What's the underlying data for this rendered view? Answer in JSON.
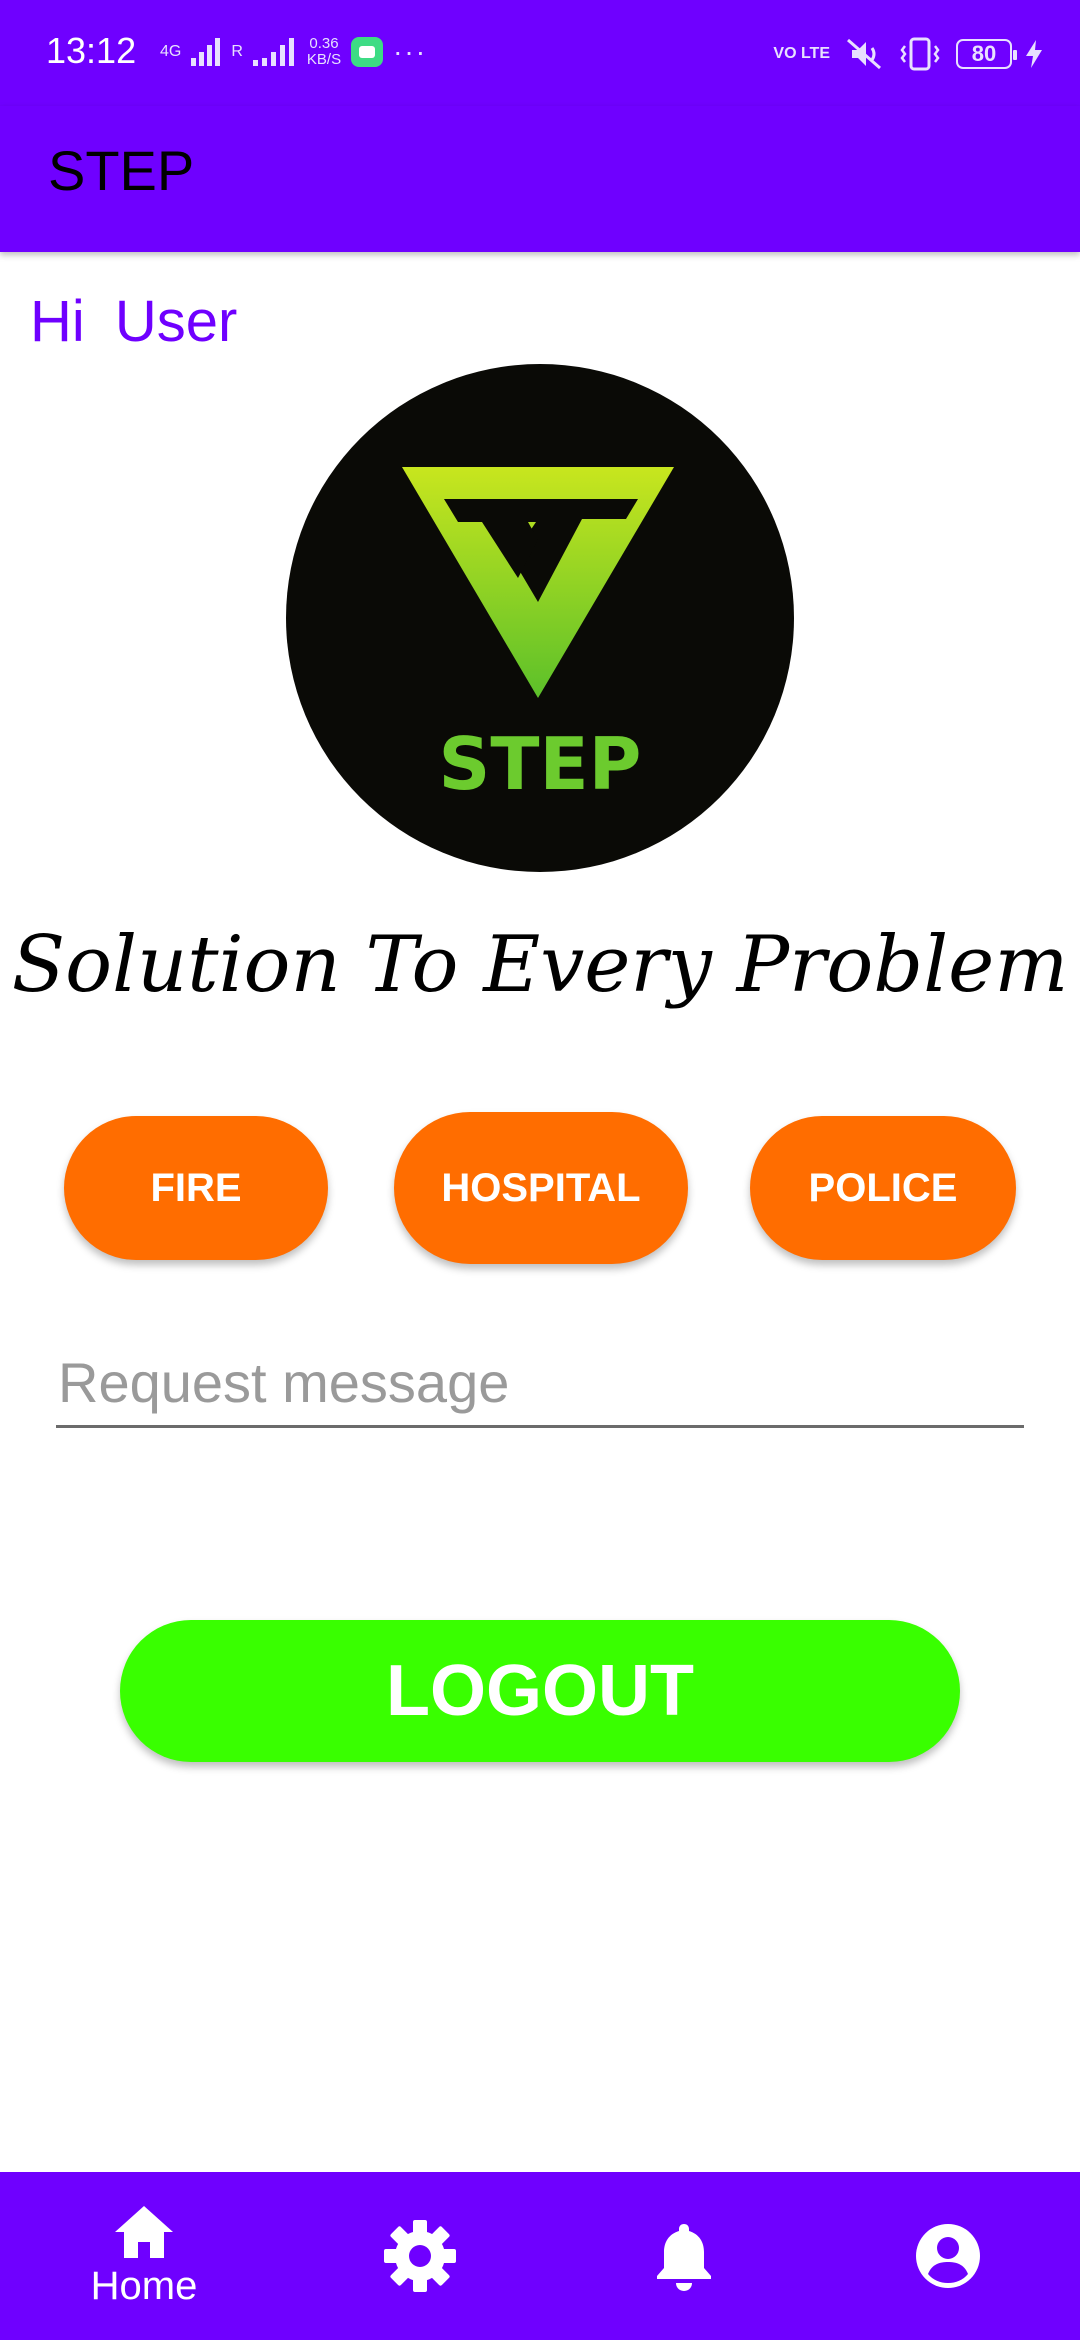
{
  "status_bar": {
    "time": "13:12",
    "network": "4G",
    "roaming": "R",
    "speed_value": "0.36",
    "speed_unit": "KB/S",
    "volte": "VO LTE",
    "battery": "80"
  },
  "app_bar": {
    "title": "STEP"
  },
  "main": {
    "greeting": "Hi  User",
    "logo_text": "STEP",
    "tagline": "Solution To Every Problem",
    "buttons": {
      "fire": "FIRE",
      "hospital": "HOSPITAL",
      "police": "POLICE"
    },
    "request_input": {
      "placeholder": "Request message",
      "value": ""
    },
    "logout": "LOGOUT"
  },
  "bottom_nav": {
    "items": [
      {
        "label": "Home",
        "icon": "home-icon",
        "active": true
      },
      {
        "label": "",
        "icon": "gear-icon"
      },
      {
        "label": "",
        "icon": "bell-icon"
      },
      {
        "label": "",
        "icon": "account-icon"
      }
    ]
  },
  "colors": {
    "primary": "#6f00ff",
    "action_orange": "#ff6d00",
    "logout_green": "#39ff00",
    "logo_green": "#8ed22a"
  }
}
